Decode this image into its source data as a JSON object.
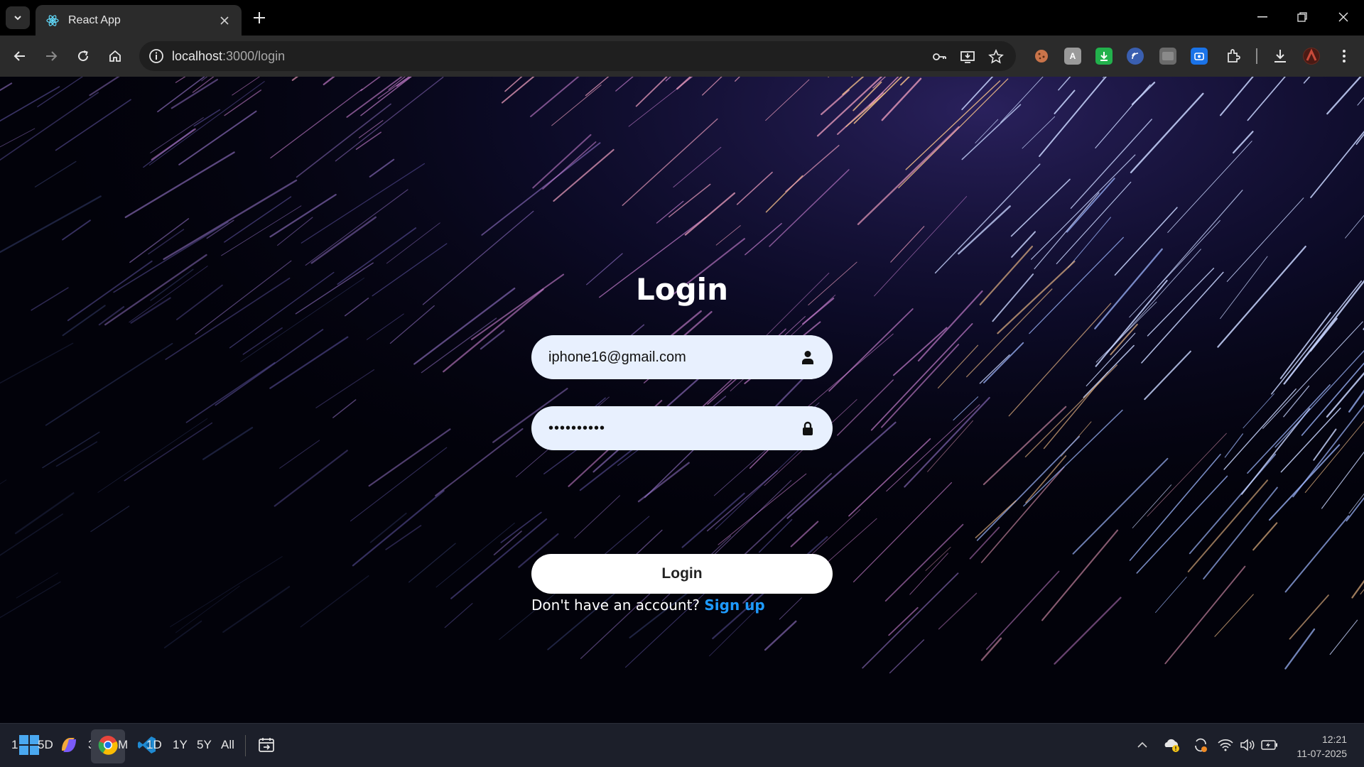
{
  "browser": {
    "tab_title": "React App",
    "url_host": "localhost",
    "url_path": ":3000/login",
    "icons": [
      "tab-search-icon",
      "react-favicon-icon",
      "close-icon",
      "new-tab-icon",
      "back-icon",
      "forward-icon",
      "reload-icon",
      "home-icon",
      "site-info-icon",
      "password-key-icon",
      "install-app-icon",
      "bookmark-star-icon",
      "extensions-icon",
      "downloads-icon",
      "profile-avatar-icon",
      "menu-icon"
    ]
  },
  "page": {
    "title": "Login",
    "email_value": "iphone16@gmail.com",
    "password_value": "••••••••••",
    "login_button_label": "Login",
    "signup_prompt": "Don't have an account?",
    "signup_link": "Sign up",
    "colors": {
      "field_bg": "#e8f0fe",
      "link": "#1e9bff",
      "button_bg": "#ffffff"
    }
  },
  "taskbar": {
    "items": [
      "1",
      "5D",
      "3",
      "M",
      "1D",
      "1Y",
      "5Y",
      "All"
    ],
    "time": "12:21",
    "date": "11-07-2025"
  }
}
